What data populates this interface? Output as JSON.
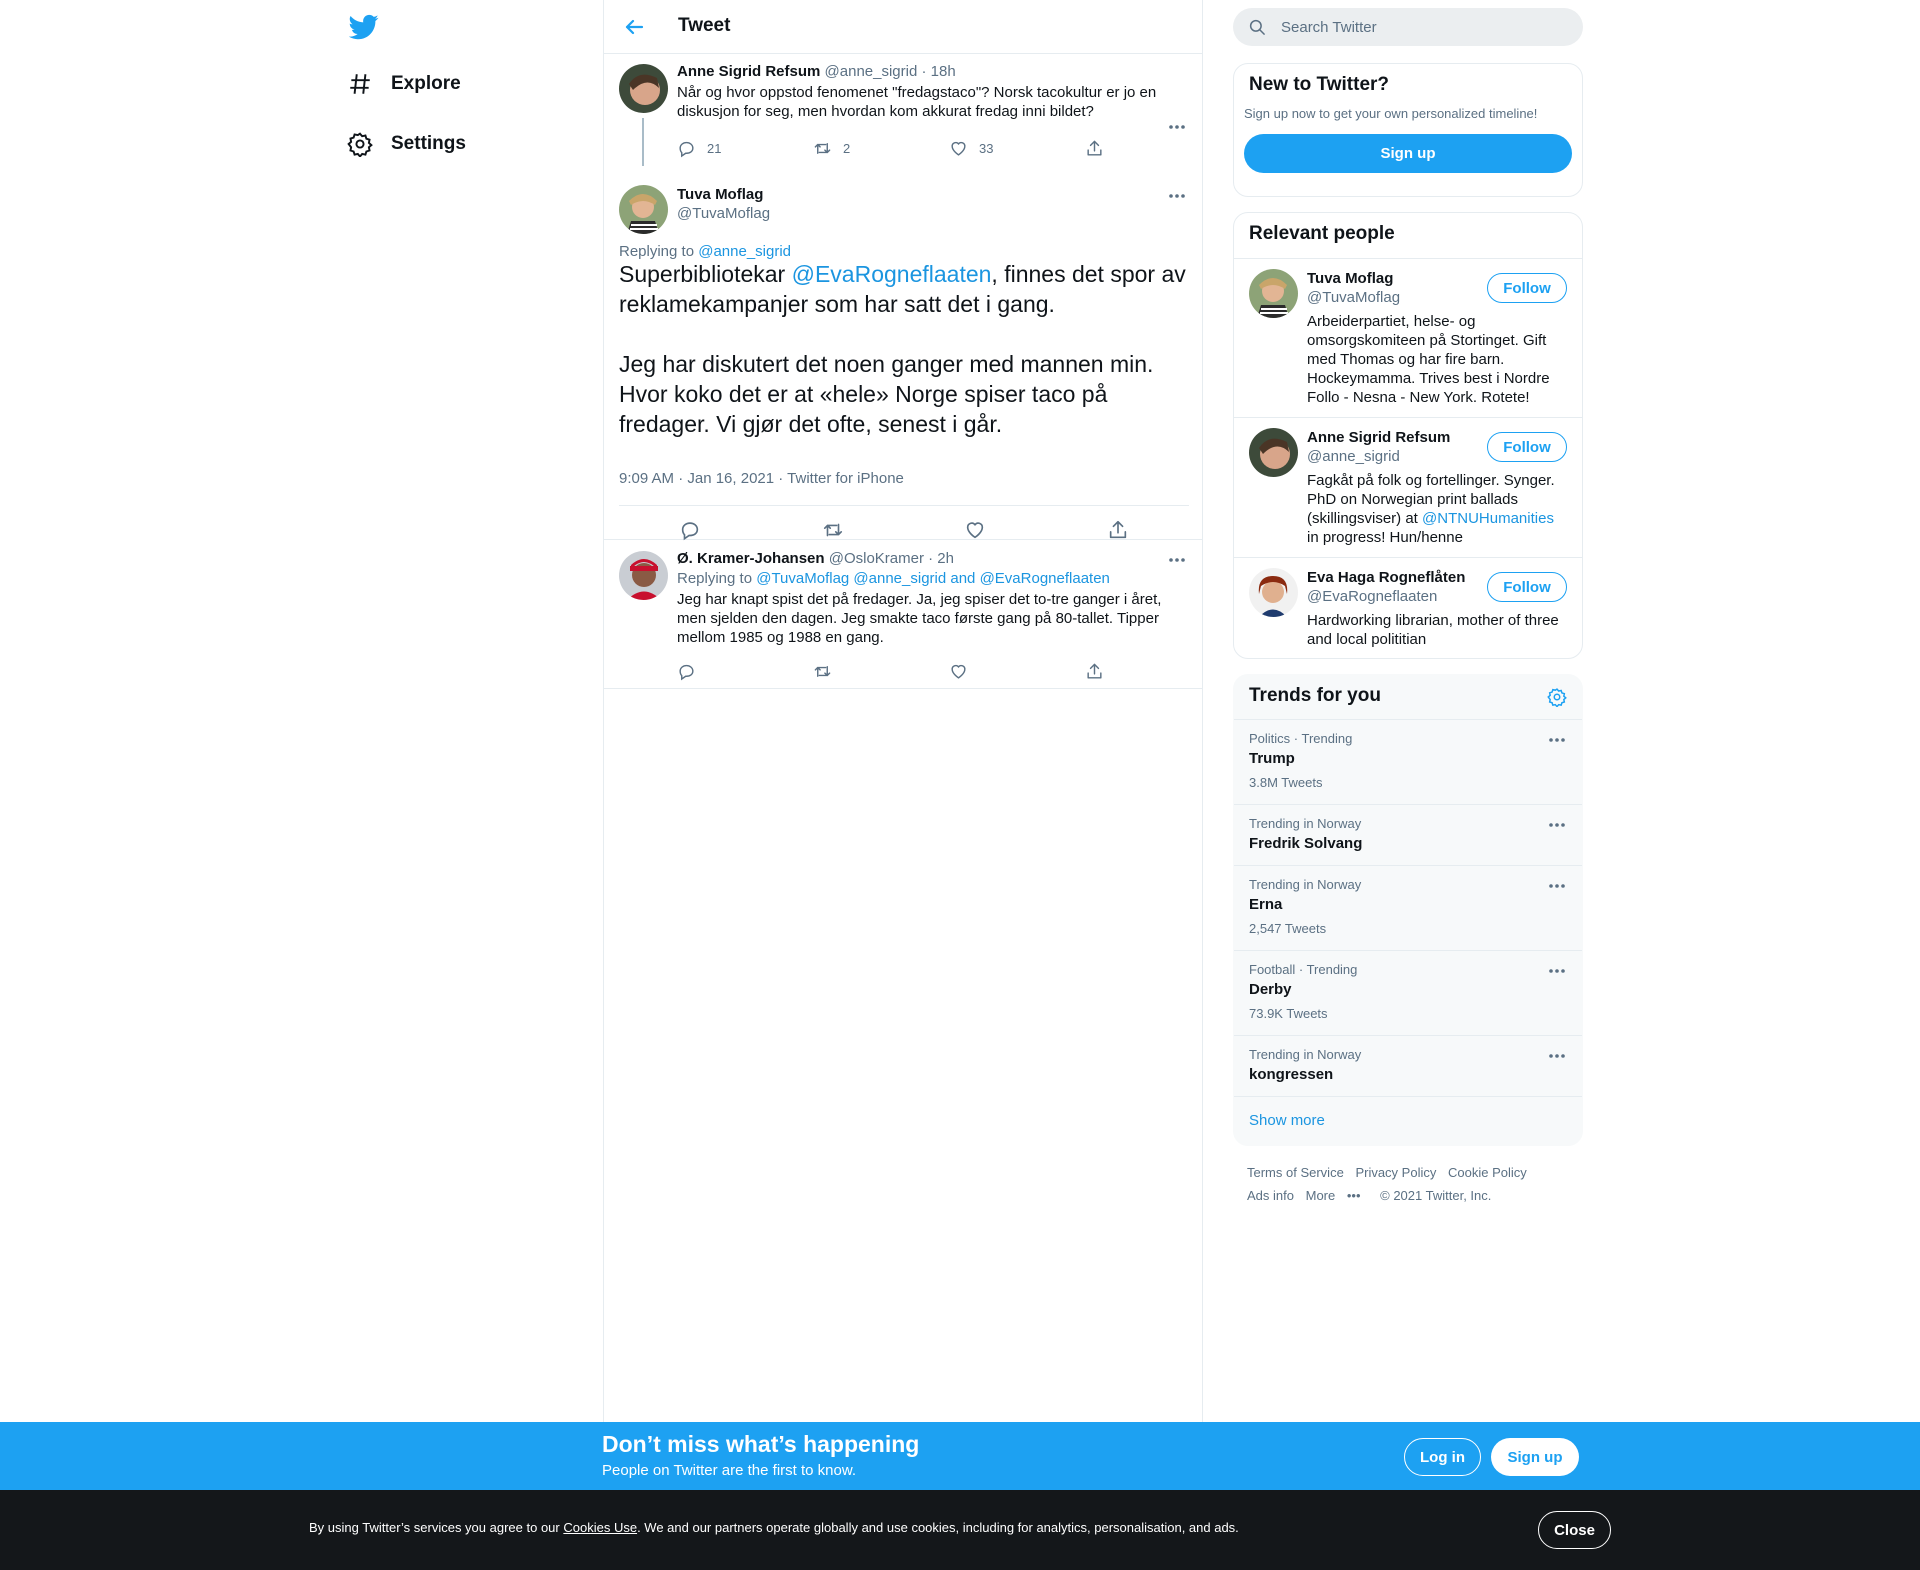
{
  "nav": {
    "explore_label": "Explore",
    "settings_label": "Settings"
  },
  "header": {
    "title": "Tweet"
  },
  "parent_tweet": {
    "name": "Anne Sigrid Refsum",
    "handle": "@anne_sigrid",
    "time": "· 18h",
    "text": "Når og hvor oppstod fenomenet \"fredagstaco\"? Norsk tacokultur er jo en diskusjon for seg, men hvordan kom akkurat fredag inni bildet?",
    "replies": "21",
    "retweets": "2",
    "likes": "33"
  },
  "focus_tweet": {
    "name": "Tuva Moflag",
    "handle": "@TuvaMoflag",
    "replying_prefix": "Replying to ",
    "replying_to": "@anne_sigrid",
    "text_part1": "Superbibliotekar ",
    "mention": "@EvaRogneflaaten",
    "text_part2": ", finnes det spor av reklamekampanjer som har satt det i gang.",
    "paragraph2": "Jeg har diskutert det noen ganger med mannen min. Hvor koko det er at «hele» Norge spiser taco på fredager. Vi gjør det ofte, senest i går.",
    "meta": "9:09 AM · Jan 16, 2021 · Twitter for iPhone"
  },
  "reply_tweet": {
    "name": "Ø. Kramer-Johansen",
    "handle": "@OsloKramer",
    "time": "· 2h",
    "replying_prefix": "Replying to ",
    "mentions": "@TuvaMoflag @anne_sigrid and @EvaRogneflaaten",
    "text": "Jeg har knapt spist det på fredager. Ja, jeg spiser det to-tre ganger i året, men sjelden den dagen. Jeg smakte taco første gang på 80-tallet. Tipper mellom 1985 og 1988 en gang."
  },
  "search": {
    "placeholder": "Search Twitter"
  },
  "new_to_twitter": {
    "title": "New to Twitter?",
    "subtitle": "Sign up now to get your own personalized timeline!",
    "button": "Sign up"
  },
  "relevant_people": {
    "title": "Relevant people",
    "follow_label": "Follow",
    "people": [
      {
        "name": "Tuva Moflag",
        "handle": "@TuvaMoflag",
        "bio": "Arbeiderpartiet, helse- og omsorgskomiteen på Stortinget. Gift med Thomas og har fire barn. Hockeymamma. Trives best i Nordre Follo - Nesna - New York. Rotete!"
      },
      {
        "name": "Anne Sigrid Refsum",
        "handle": "@anne_sigrid",
        "bio_part1": "Fagkåt på folk og fortellinger. Synger. PhD on Norwegian print ballads (skillingsviser) at ",
        "bio_mention": "@NTNUHumanities",
        "bio_part2": " in progress! Hun/henne"
      },
      {
        "name": "Eva Haga Rogneflåten",
        "handle": "@EvaRogneflaaten",
        "bio": "Hardworking librarian, mother of three and local polititian"
      }
    ]
  },
  "trends": {
    "title": "Trends for you",
    "items": [
      {
        "meta": "Politics · Trending",
        "name": "Trump",
        "count": "3.8M Tweets"
      },
      {
        "meta": "Trending in Norway",
        "name": "Fredrik Solvang",
        "count": ""
      },
      {
        "meta": "Trending in Norway",
        "name": "Erna",
        "count": "2,547 Tweets"
      },
      {
        "meta": "Football · Trending",
        "name": "Derby",
        "count": "73.9K Tweets"
      },
      {
        "meta": "Trending in Norway",
        "name": "kongressen",
        "count": ""
      }
    ],
    "show_more": "Show more"
  },
  "footer": {
    "terms": "Terms of Service",
    "privacy": "Privacy Policy",
    "cookie": "Cookie Policy",
    "ads": "Ads info",
    "more": "More",
    "copyright": "© 2021 Twitter, Inc."
  },
  "bottom_bar": {
    "title": "Don’t miss what’s happening",
    "subtitle": "People on Twitter are the first to know.",
    "login": "Log in",
    "signup": "Sign up"
  },
  "cookie_bar": {
    "text_before": "By using Twitter’s services you agree to our ",
    "link": "Cookies Use",
    "text_after": ". We and our partners operate globally and use cookies, including for analytics, personalisation, and ads.",
    "close": "Close"
  },
  "colors": {
    "accent": "#1da1f2",
    "link": "#1b95e0",
    "secondary_text": "#5b7083",
    "cookie_bar_bg": "#14171a"
  }
}
